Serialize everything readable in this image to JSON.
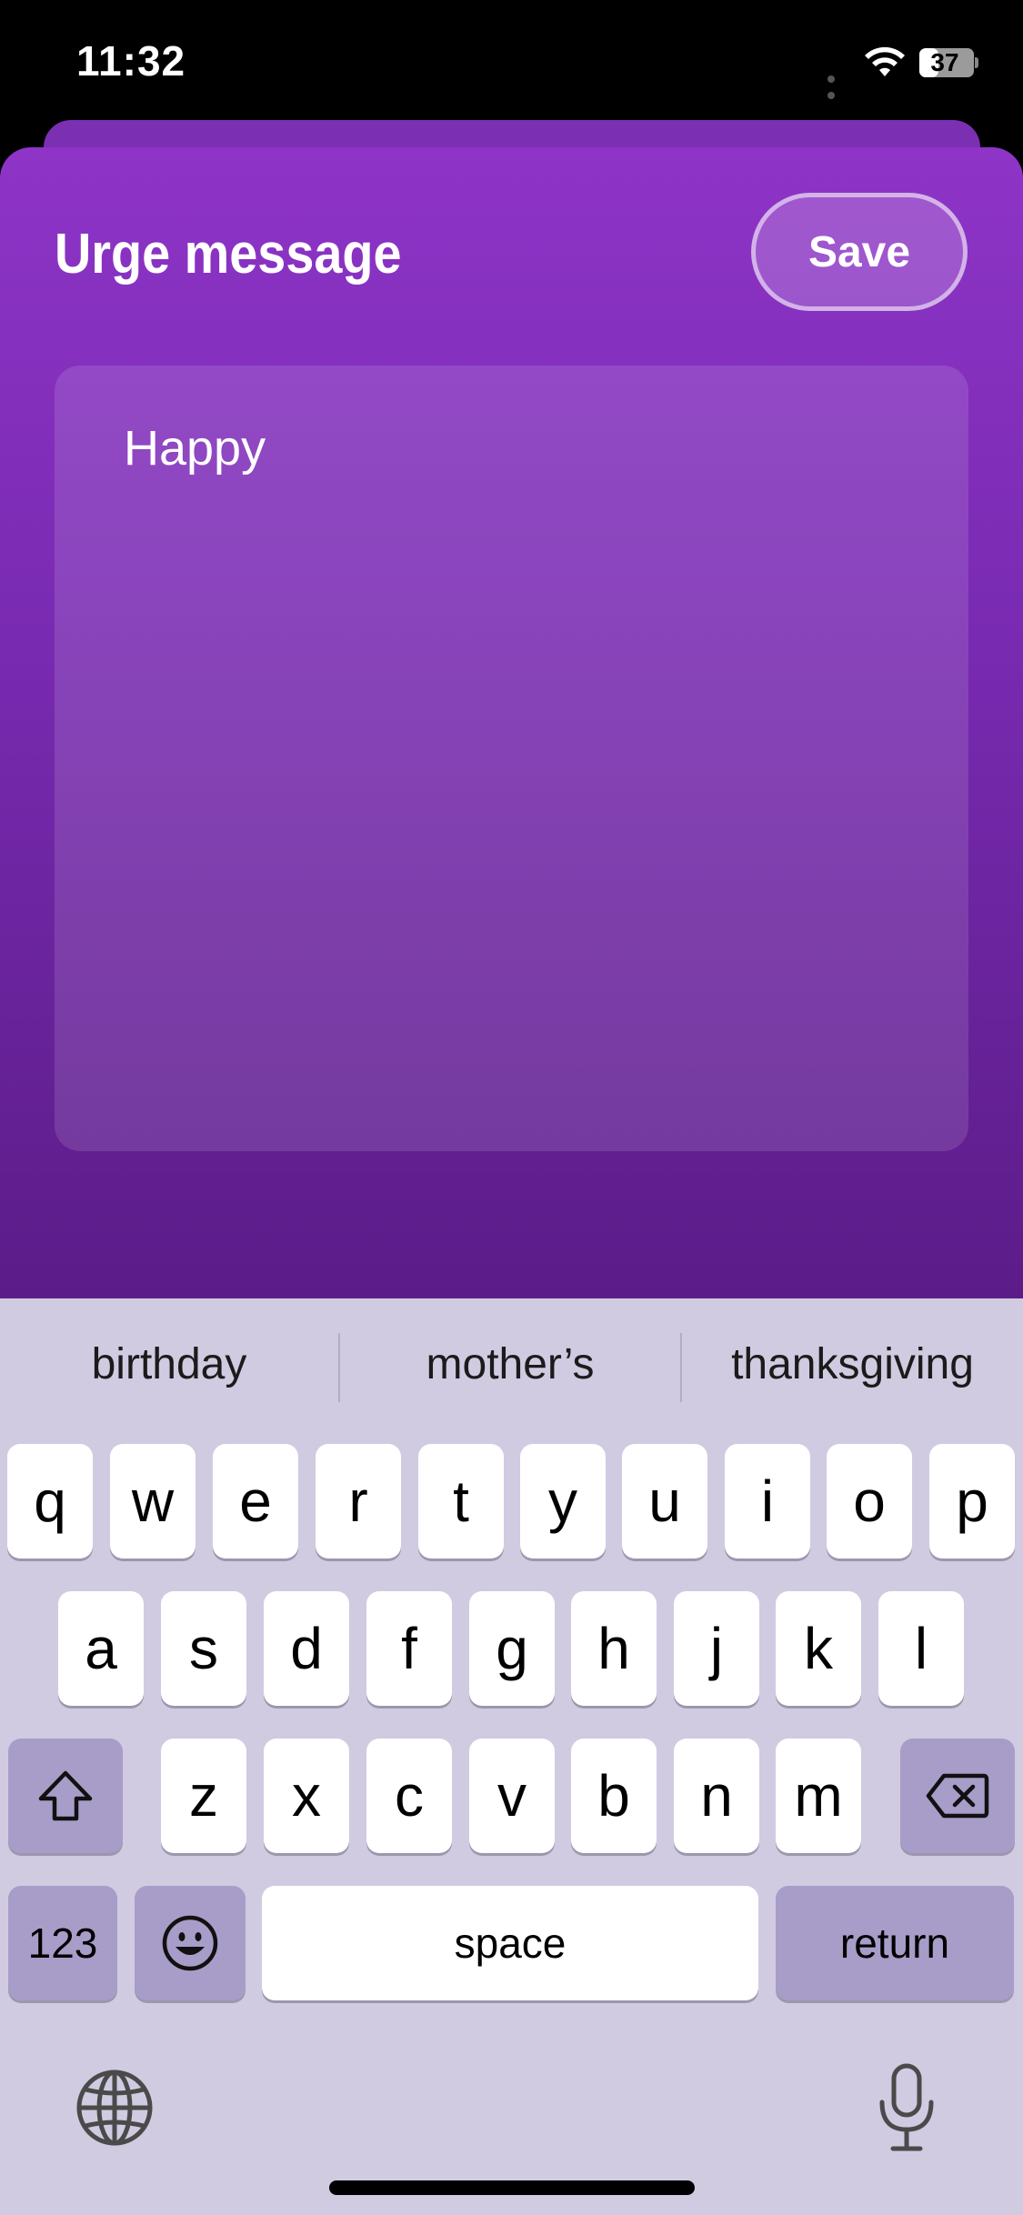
{
  "status_bar": {
    "time": "11:32",
    "battery": "37",
    "battery_level": 0.37
  },
  "sheet": {
    "title": "Urge message",
    "save_label": "Save"
  },
  "message": {
    "text": "Happy"
  },
  "keyboard": {
    "suggestions": [
      "birthday",
      "mother’s",
      "thanksgiving"
    ],
    "row1": [
      "q",
      "w",
      "e",
      "r",
      "t",
      "y",
      "u",
      "i",
      "o",
      "p"
    ],
    "row2": [
      "a",
      "s",
      "d",
      "f",
      "g",
      "h",
      "j",
      "k",
      "l"
    ],
    "row3": [
      "z",
      "x",
      "c",
      "v",
      "b",
      "n",
      "m"
    ],
    "numbers_label": "123",
    "space_label": "space",
    "return_label": "return",
    "icons": {
      "shift": "shift-icon",
      "delete": "delete-icon",
      "emoji": "emoji-icon",
      "globe": "globe-icon",
      "mic": "microphone-icon"
    }
  },
  "colors": {
    "sheet_top": "#8e34c7",
    "sheet_bottom": "#5b1c88",
    "keyboard_bg": "#d0cbe1",
    "modifier_key": "#a89dc8"
  }
}
